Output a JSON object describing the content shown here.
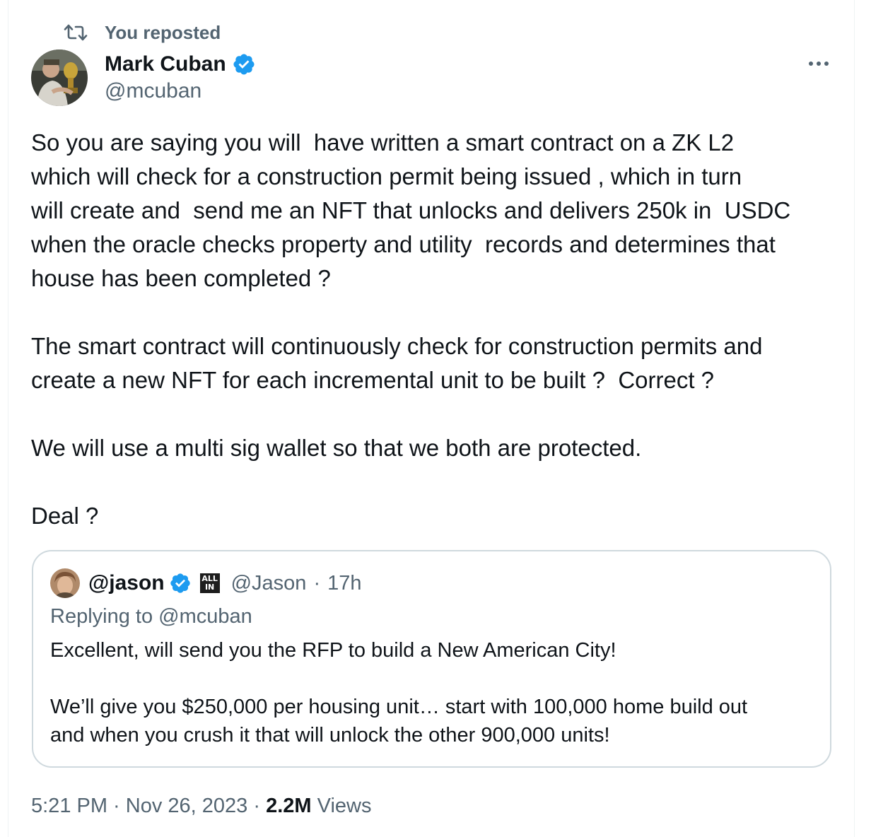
{
  "repost": {
    "text": "You reposted",
    "icon": "repost-icon"
  },
  "author": {
    "name": "Mark Cuban",
    "handle": "@mcuban",
    "verified": true,
    "verified_color": "#1d9bf0"
  },
  "tweet": {
    "paragraphs": [
      "So you are saying you will  have written a smart contract on a ZK L2\nwhich will check for a construction permit being issued , which in turn\nwill create and  send me an NFT that unlocks and delivers 250k in  USDC\nwhen the oracle checks property and utility  records and determines that\nhouse has been completed ?",
      "The smart contract will continuously check for construction permits and\ncreate a new NFT for each incremental unit to be built ?  Correct ?",
      "We will use a multi sig wallet so that we both are protected.",
      "Deal ?"
    ]
  },
  "quoted": {
    "name": "@jason",
    "badge_line1": "ALL",
    "badge_line2": "IN",
    "handle": "@Jason",
    "separator": "·",
    "time": "17h",
    "replying_to": "Replying to @mcuban",
    "paragraphs": [
      "Excellent, will send you the RFP to build a New American City!",
      "We’ll give you $250,000 per housing unit… start with 100,000 home build out\nand when you crush it that will unlock the other 900,000 units!"
    ]
  },
  "meta": {
    "time": "5:21 PM",
    "sep1": " · ",
    "date": "Nov 26, 2023",
    "sep2": " · ",
    "views_count": "2.2M",
    "views_label": " Views"
  },
  "colors": {
    "text_primary": "#0f1419",
    "text_secondary": "#536471",
    "border": "#cfd9de",
    "verified": "#1d9bf0"
  }
}
